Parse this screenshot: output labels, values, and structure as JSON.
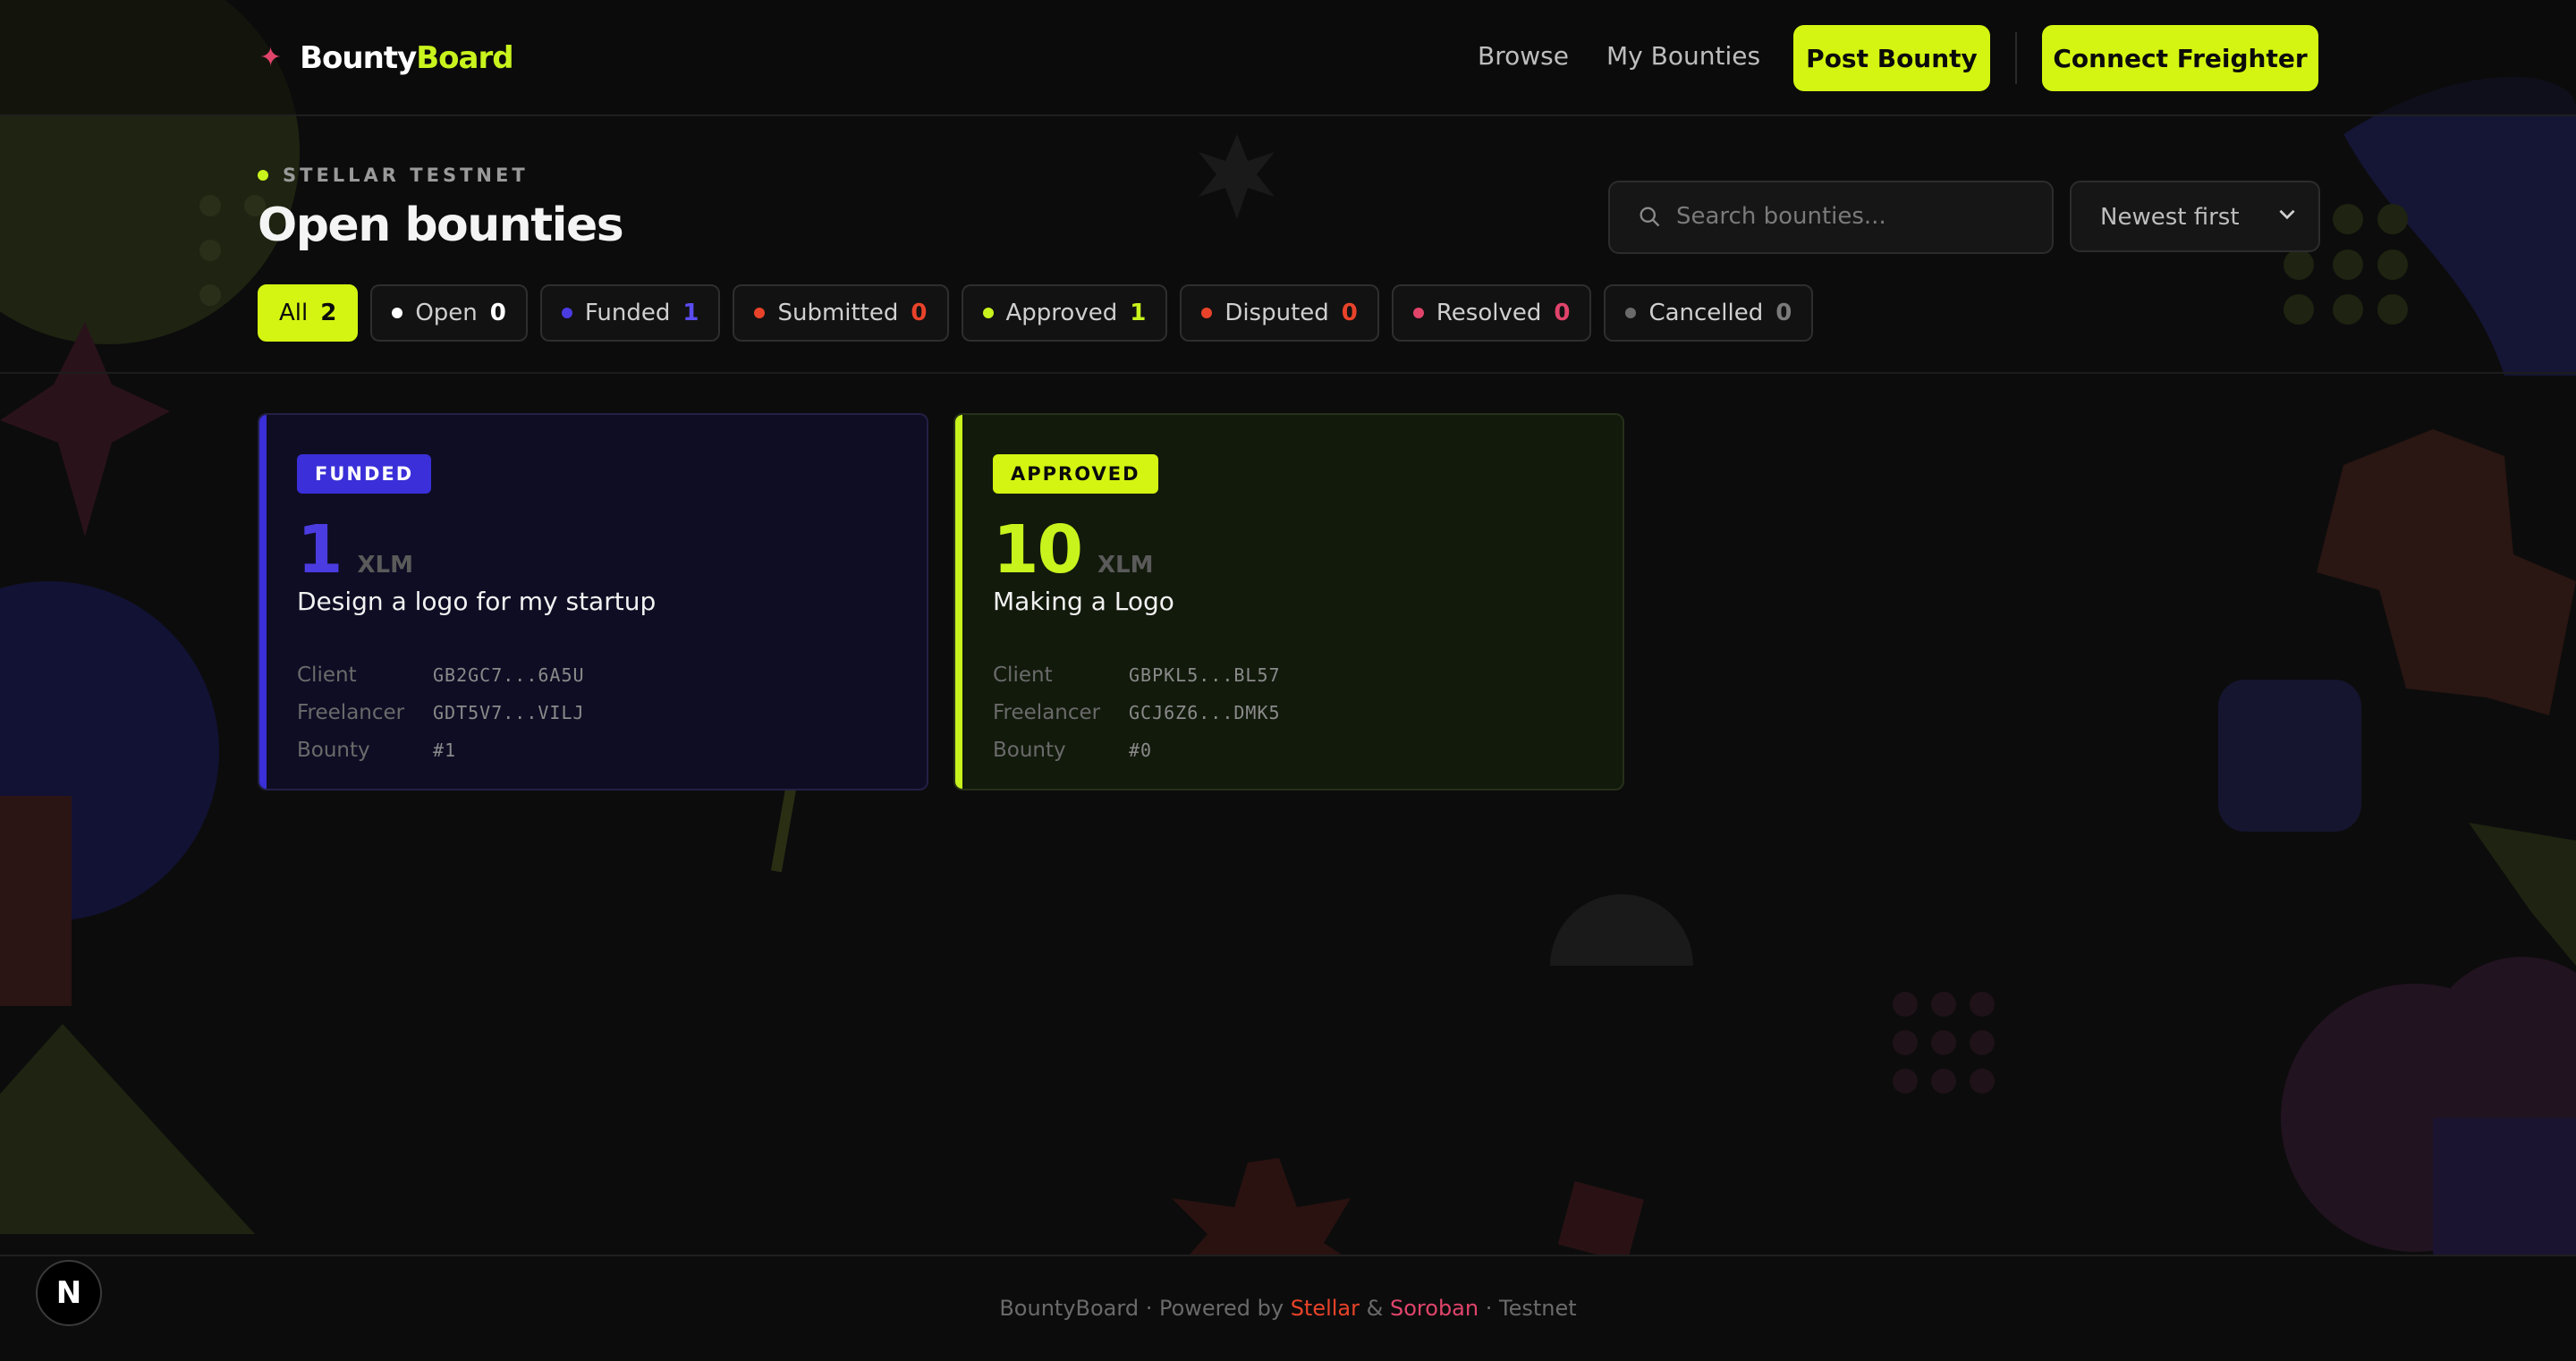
{
  "brand": {
    "name_part1": "Bounty",
    "name_part2": "Board"
  },
  "nav": {
    "browse": "Browse",
    "my_bounties": "My Bounties",
    "post_bounty": "Post Bounty",
    "connect": "Connect Freighter"
  },
  "page": {
    "eyebrow": "STELLAR TESTNET",
    "title": "Open bounties"
  },
  "search": {
    "placeholder": "Search bounties..."
  },
  "sort": {
    "selected": "Newest first"
  },
  "filters": [
    {
      "label": "All",
      "count": "2",
      "dot_color": "",
      "count_color": "#0b0b0b"
    },
    {
      "label": "Open",
      "count": "0",
      "dot_color": "#ffffff",
      "count_color": "#ffffff"
    },
    {
      "label": "Funded",
      "count": "1",
      "dot_color": "#4a3ce0",
      "count_color": "#5a4cf0"
    },
    {
      "label": "Submitted",
      "count": "0",
      "dot_color": "#e8432a",
      "count_color": "#e8432a"
    },
    {
      "label": "Approved",
      "count": "1",
      "dot_color": "#c8f31d",
      "count_color": "#c8f31d"
    },
    {
      "label": "Disputed",
      "count": "0",
      "dot_color": "#e8432a",
      "count_color": "#e8432a"
    },
    {
      "label": "Resolved",
      "count": "0",
      "dot_color": "#e0446b",
      "count_color": "#e0446b"
    },
    {
      "label": "Cancelled",
      "count": "0",
      "dot_color": "#6a6a6a",
      "count_color": "#7a7a7a"
    }
  ],
  "cards": [
    {
      "status": "FUNDED",
      "amount": "1",
      "unit": "XLM",
      "title": "Design a logo for my startup",
      "client_label": "Client",
      "client": "GB2GC7...6A5U",
      "freelancer_label": "Freelancer",
      "freelancer": "GDT5V7...VILJ",
      "bounty_label": "Bounty",
      "bounty": "#1",
      "accent": "#3a2fd8"
    },
    {
      "status": "APPROVED",
      "amount": "10",
      "unit": "XLM",
      "title": "Making a Logo",
      "client_label": "Client",
      "client": "GBPKL5...BL57",
      "freelancer_label": "Freelancer",
      "freelancer": "GCJ6Z6...DMK5",
      "bounty_label": "Bounty",
      "bounty": "#0",
      "accent": "#c8f31d"
    }
  ],
  "footer": {
    "part1": "BountyBoard · Powered by ",
    "stellar": "Stellar",
    "amp": " & ",
    "soroban": "Soroban",
    "part2": " · Testnet"
  },
  "dev_badge": "N",
  "colors": {
    "lime": "#d4f512",
    "bg": "#0c0c0c",
    "indigo": "#3a2fd8",
    "pink": "#e0446b",
    "red": "#e8432a"
  }
}
